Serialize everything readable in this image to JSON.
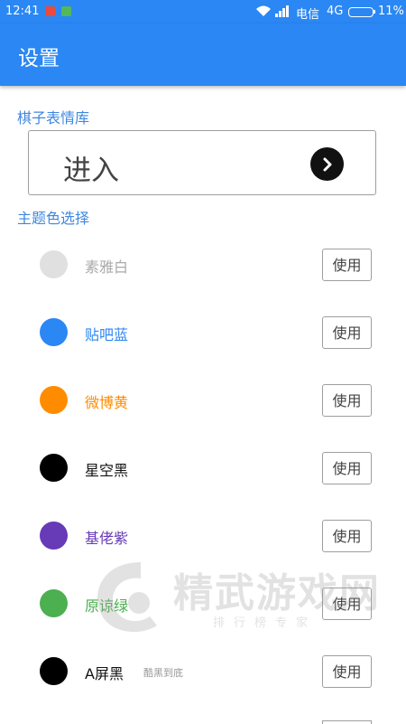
{
  "status_bar": {
    "time": "12:41",
    "carrier": "电信",
    "network": "4G",
    "battery": "11%"
  },
  "app_bar": {
    "title": "设置"
  },
  "emoji_section": {
    "label": "棋子表情库",
    "enter_label": "进入"
  },
  "theme_section": {
    "label": "主题色选择",
    "themes": [
      {
        "name": "素雅白",
        "color": "#e0e0e0",
        "text_color": "#aaaaaa",
        "button": "使用"
      },
      {
        "name": "贴吧蓝",
        "color": "#2b87f3",
        "text_color": "#2b87f3",
        "button": "使用"
      },
      {
        "name": "微博黄",
        "color": "#ff8c00",
        "text_color": "#ff8c00",
        "button": "使用"
      },
      {
        "name": "星空黑",
        "color": "#000000",
        "text_color": "#111111",
        "button": "使用"
      },
      {
        "name": "基佬紫",
        "color": "#673ab7",
        "text_color": "#673ab7",
        "button": "使用"
      },
      {
        "name": "原谅绿",
        "color": "#4caf50",
        "text_color": "#4caf50",
        "button": "使用"
      },
      {
        "name": "A屏黑",
        "color": "#000000",
        "text_color": "#111111",
        "button": "使用",
        "note": "酷黑到底"
      }
    ]
  },
  "watermark": {
    "title": "精武游戏网",
    "subtitle": "排行榜专家"
  },
  "colors": {
    "primary": "#2b87f3",
    "section_label": "#3e87e0"
  }
}
